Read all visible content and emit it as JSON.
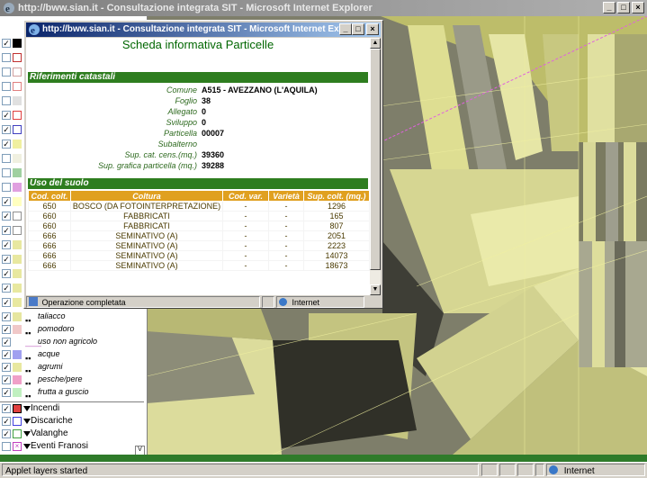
{
  "window": {
    "title": "http://bww.sian.it - Consultazione integrata SIT - Microsoft Internet Explorer"
  },
  "popup": {
    "title": "http://bww.sian.it - Consultazione integrata SIT - Microsoft Internet Explorer",
    "heading": "Scheda informativa Particelle",
    "section_catastali": "Riferimenti catastali",
    "fields": [
      {
        "label": "Comune",
        "value": "A515 - AVEZZANO (L'AQUILA)"
      },
      {
        "label": "Foglio",
        "value": "38"
      },
      {
        "label": "Allegato",
        "value": "0"
      },
      {
        "label": "Sviluppo",
        "value": "0"
      },
      {
        "label": "Particella",
        "value": "00007"
      },
      {
        "label": "Subalterno",
        "value": ""
      },
      {
        "label": "Sup. cat. cens.(mq.)",
        "value": "39360"
      },
      {
        "label": "Sup. grafica particella (mq.)",
        "value": "39288"
      }
    ],
    "section_uso": "Uso del suolo",
    "table": {
      "headers": [
        "Cod. colt.",
        "Coltura",
        "Cod. var.",
        "Varietà",
        "Sup. colt. (mq.)"
      ],
      "rows": [
        [
          "650",
          "BOSCO (DA FOTOINTERPRETAZIONE)",
          "-",
          "-",
          "1296"
        ],
        [
          "660",
          "FABBRICATI",
          "-",
          "-",
          "165"
        ],
        [
          "660",
          "FABBRICATI",
          "-",
          "-",
          "807"
        ],
        [
          "666",
          "SEMINATIVO (A)",
          "-",
          "-",
          "2051"
        ],
        [
          "666",
          "SEMINATIVO (A)",
          "-",
          "-",
          "2223"
        ],
        [
          "666",
          "SEMINATIVO (A)",
          "-",
          "-",
          "14073"
        ],
        [
          "666",
          "SEMINATIVO (A)",
          "-",
          "-",
          "18673"
        ]
      ]
    },
    "status_text": "Operazione completata",
    "zone_text": "Internet"
  },
  "layers": {
    "items": [
      {
        "label": "taliacco",
        "color": "#e6e6a0"
      },
      {
        "label": "pomodoro",
        "color": "#f0c8c8"
      },
      {
        "label": "uso non agricolo",
        "color": "#c060c0"
      },
      {
        "label": "acque",
        "color": "#a0a0f0"
      },
      {
        "label": "agrumi",
        "color": "#e8e8a0"
      },
      {
        "label": "pesche/pere",
        "color": "#f0a0c8"
      },
      {
        "label": "frutta a guscio",
        "color": "#c0f0c0"
      }
    ],
    "groups": [
      {
        "label": "Incendi",
        "color": "#e04040"
      },
      {
        "label": "Discariche",
        "color": "#4040e0"
      },
      {
        "label": "Valanghe",
        "color": "#40a040"
      },
      {
        "label": "Eventi Franosi",
        "color": "#c040c0"
      }
    ]
  },
  "statusbar": {
    "text": "Applet layers started",
    "zone": "Internet"
  },
  "colors": {
    "section": "#2e7d1f",
    "table_header": "#e0a020",
    "title_bar": "#0a246a"
  }
}
